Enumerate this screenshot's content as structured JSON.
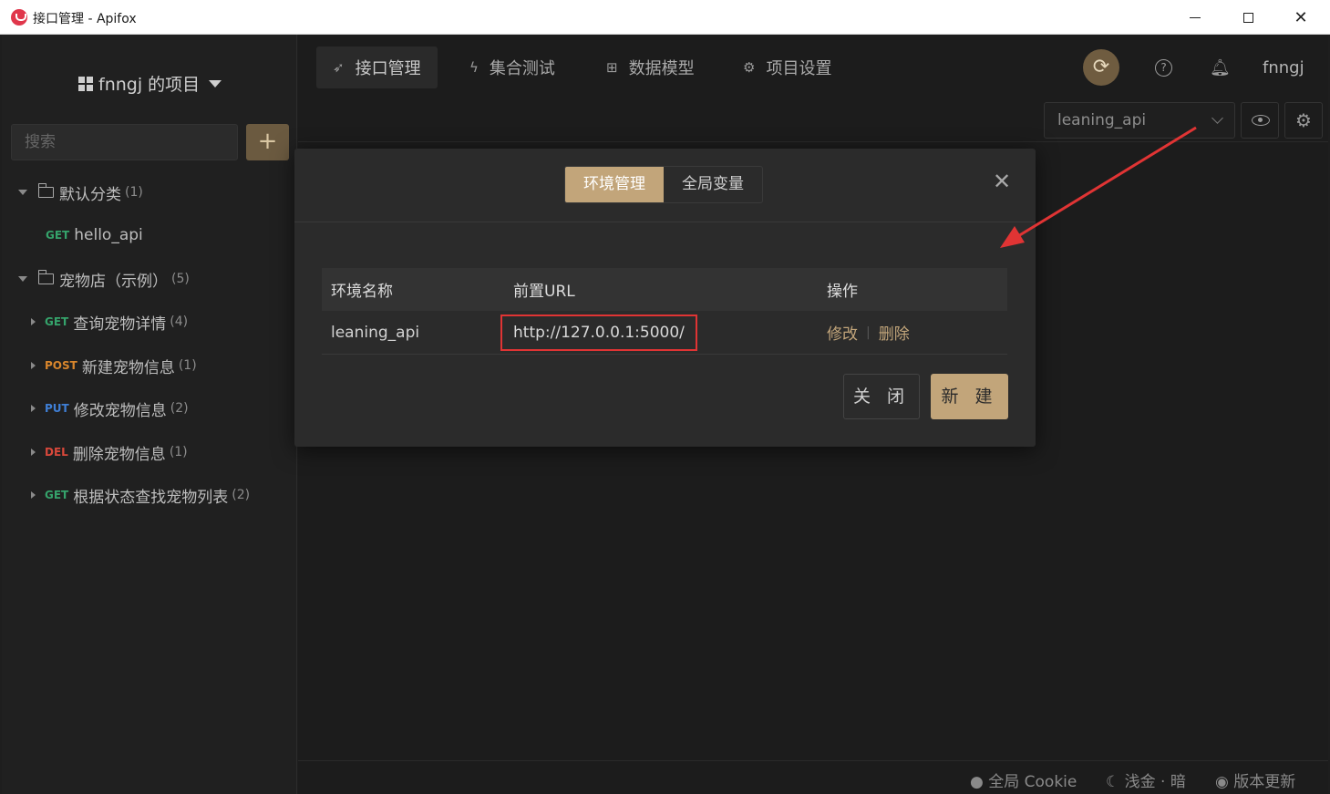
{
  "window": {
    "title": "接口管理 - Apifox"
  },
  "sidebar": {
    "project_name": "fnngj 的项目",
    "search_placeholder": "搜索",
    "add_label": "+",
    "tree": [
      {
        "kind": "folder",
        "label": "默认分类",
        "count": "(1)"
      },
      {
        "kind": "api",
        "method": "GET",
        "label": "hello_api",
        "count": ""
      },
      {
        "kind": "folder",
        "label": "宠物店（示例）",
        "count": "(5)"
      },
      {
        "kind": "group",
        "method": "GET",
        "label": "查询宠物详情",
        "count": "(4)"
      },
      {
        "kind": "group",
        "method": "POST",
        "label": "新建宠物信息",
        "count": "(1)"
      },
      {
        "kind": "group",
        "method": "PUT",
        "label": "修改宠物信息",
        "count": "(2)"
      },
      {
        "kind": "group",
        "method": "DEL",
        "label": "删除宠物信息",
        "count": "(1)"
      },
      {
        "kind": "group",
        "method": "GET",
        "label": "根据状态查找宠物列表",
        "count": "(2)"
      }
    ]
  },
  "header": {
    "tabs": [
      {
        "label": "接口管理",
        "icon": "rocket-icon",
        "active": true
      },
      {
        "label": "集合测试",
        "icon": "lightning-icon",
        "active": false
      },
      {
        "label": "数据模型",
        "icon": "model-icon",
        "active": false
      },
      {
        "label": "项目设置",
        "icon": "gear-icon",
        "active": false
      }
    ],
    "user": "fnngj",
    "env_selected": "leaning_api"
  },
  "modal": {
    "tabs": [
      "环境管理",
      "全局变量"
    ],
    "table": {
      "headers": [
        "环境名称",
        "前置URL",
        "操作"
      ],
      "rows": [
        {
          "name": "leaning_api",
          "url": "http://127.0.0.1:5000/",
          "edit": "修改",
          "delete": "删除"
        }
      ]
    },
    "close_label": "关 闭",
    "new_label": "新 建"
  },
  "footer": {
    "cookie": "全局 Cookie",
    "theme": "浅金 · 暗",
    "update": "版本更新"
  },
  "colors": {
    "accent": "#c2a57a",
    "highlight_border": "#e03434",
    "get": "#35a36b",
    "post": "#d9862c",
    "put": "#3f7fd6",
    "del": "#d9483b"
  }
}
